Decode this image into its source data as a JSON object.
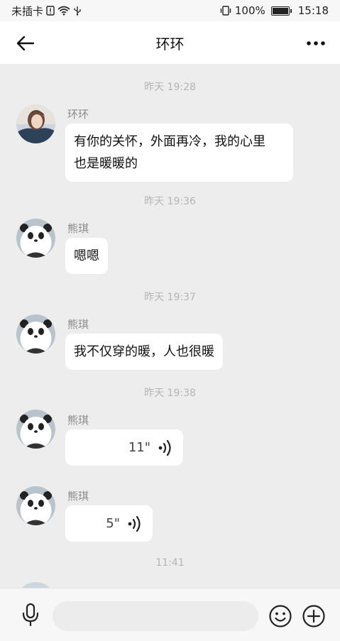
{
  "status_bar": {
    "carrier": "未插卡",
    "battery": "100%",
    "battery_level": 1.0,
    "time": "15:18"
  },
  "header": {
    "title": "环环"
  },
  "messages": [
    {
      "time": "昨天 19:28",
      "sender": "环环",
      "text": "有你的关怀，外面再冷，我的心里\n也是暖暖的",
      "avatar": "woman-photo"
    },
    {
      "time": "昨天 19:36",
      "sender": "熊琪",
      "text": "嗯嗯",
      "avatar": "panda"
    },
    {
      "time": "昨天 19:37",
      "sender": "熊琪",
      "text": "我不仅穿的暖，人也很暖",
      "avatar": "panda"
    },
    {
      "time": "昨天 19:38",
      "sender": "熊琪",
      "voice_duration": "11\"",
      "avatar": "panda"
    },
    {
      "sender": "熊琪",
      "voice_duration": "5\"",
      "avatar": "panda"
    },
    {
      "time": "11:41"
    }
  ],
  "icons": {
    "back": "arrow-left-icon",
    "more": "more-dots-icon",
    "mic": "microphone-icon",
    "emoji": "smiley-icon",
    "plus": "plus-circle-icon",
    "voice": "voice-wave-icon"
  },
  "colors": {
    "background": "#ededed",
    "bubble": "#ffffff",
    "timestamp": "#b5b5b5",
    "sender": "#8a8a8a"
  }
}
